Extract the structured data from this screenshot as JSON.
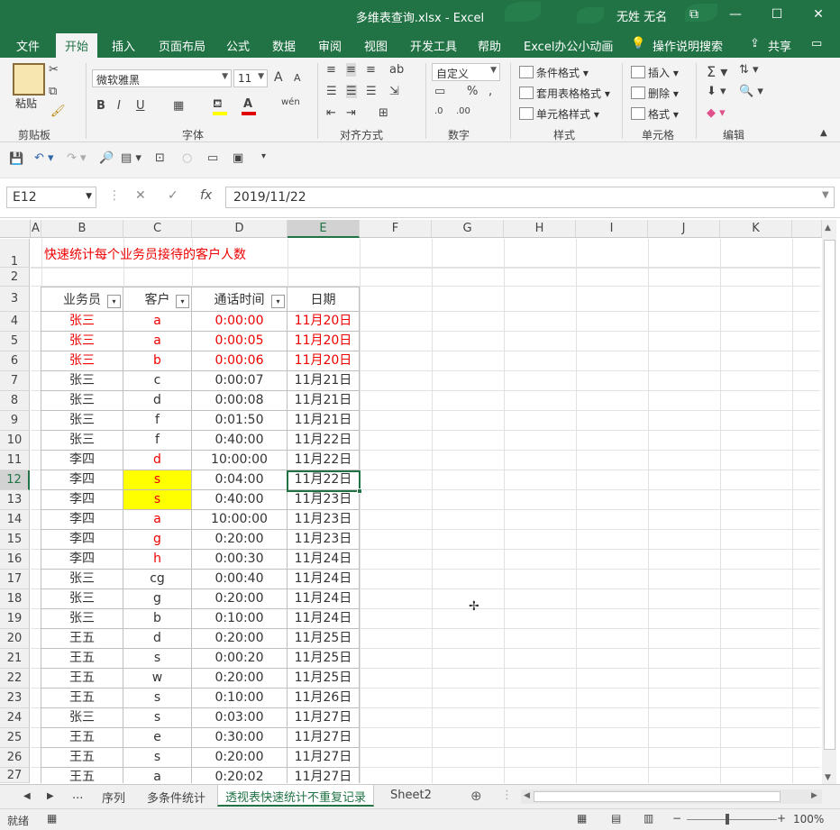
{
  "window": {
    "title": "多维表查询.xlsx  -  Excel",
    "user": "无姓 无名",
    "controls": [
      "⧉",
      "—",
      "☐",
      "✕"
    ]
  },
  "ribbon_tabs": [
    "文件",
    "开始",
    "插入",
    "页面布局",
    "公式",
    "数据",
    "审阅",
    "视图",
    "开发工具",
    "帮助",
    "Excel办公小动画",
    "操作说明搜索",
    "共享"
  ],
  "ribbon": {
    "clipboard": {
      "paste": "粘贴",
      "label": "剪贴板"
    },
    "font": {
      "name": "微软雅黑",
      "size": "11",
      "bold": "B",
      "italic": "I",
      "underline": "U",
      "grow": "A",
      "shrink": "A",
      "fill_color": "#ffff00",
      "font_color": "#e00000",
      "label": "字体",
      "phonetic": "wén"
    },
    "alignment": {
      "label": "对齐方式"
    },
    "number": {
      "format": "自定义",
      "label": "数字"
    },
    "styles": {
      "cond": "条件格式",
      "table": "套用表格格式",
      "cell": "单元格样式",
      "label": "样式"
    },
    "cells": {
      "insert": "插入",
      "delete": "删除",
      "format": "格式",
      "label": "单元格"
    },
    "editing": {
      "label": "编辑"
    }
  },
  "formula_bar": {
    "name_box": "E12",
    "cancel": "✕",
    "enter": "✓",
    "fx": "fx",
    "value": "2019/11/22"
  },
  "columns": [
    "A",
    "B",
    "C",
    "D",
    "E",
    "F",
    "G",
    "H",
    "I",
    "J",
    "K"
  ],
  "rows": [
    "1",
    "2",
    "3",
    "4",
    "5",
    "6",
    "7",
    "8",
    "9",
    "10",
    "11",
    "12",
    "13",
    "14",
    "15",
    "16",
    "17",
    "18",
    "19",
    "20",
    "21",
    "22",
    "23",
    "24",
    "25",
    "26",
    "27"
  ],
  "sheet_title": "快速统计每个业务员接待的客户人数",
  "table": {
    "headers": [
      "业务员",
      "客户",
      "通话时间",
      "日期"
    ],
    "filter_glyph": "▾",
    "rows": [
      {
        "name": "张三",
        "client": "a",
        "time": "0:00:00",
        "date": "11月20日"
      },
      {
        "name": "张三",
        "client": "a",
        "time": "0:00:05",
        "date": "11月20日"
      },
      {
        "name": "张三",
        "client": "b",
        "time": "0:00:06",
        "date": "11月20日"
      },
      {
        "name": "张三",
        "client": "c",
        "time": "0:00:07",
        "date": "11月21日"
      },
      {
        "name": "张三",
        "client": "d",
        "time": "0:00:08",
        "date": "11月21日"
      },
      {
        "name": "张三",
        "client": "f",
        "time": "0:01:50",
        "date": "11月21日"
      },
      {
        "name": "张三",
        "client": "f",
        "time": "0:40:00",
        "date": "11月22日"
      },
      {
        "name": "李四",
        "client": "d",
        "time": "10:00:00",
        "date": "11月22日"
      },
      {
        "name": "李四",
        "client": "s",
        "time": "0:04:00",
        "date": "11月22日"
      },
      {
        "name": "李四",
        "client": "s",
        "time": "0:40:00",
        "date": "11月23日"
      },
      {
        "name": "李四",
        "client": "a",
        "time": "10:00:00",
        "date": "11月23日"
      },
      {
        "name": "李四",
        "client": "g",
        "time": "0:20:00",
        "date": "11月23日"
      },
      {
        "name": "李四",
        "client": "h",
        "time": "0:00:30",
        "date": "11月24日"
      },
      {
        "name": "张三",
        "client": "cg",
        "time": "0:00:40",
        "date": "11月24日"
      },
      {
        "name": "张三",
        "client": "g",
        "time": "0:20:00",
        "date": "11月24日"
      },
      {
        "name": "张三",
        "client": "b",
        "time": "0:10:00",
        "date": "11月24日"
      },
      {
        "name": "王五",
        "client": "d",
        "time": "0:20:00",
        "date": "11月25日"
      },
      {
        "name": "王五",
        "client": "s",
        "time": "0:00:20",
        "date": "11月25日"
      },
      {
        "name": "王五",
        "client": "w",
        "time": "0:20:00",
        "date": "11月25日"
      },
      {
        "name": "王五",
        "client": "s",
        "time": "0:10:00",
        "date": "11月26日"
      },
      {
        "name": "张三",
        "client": "s",
        "time": "0:03:00",
        "date": "11月27日"
      },
      {
        "name": "王五",
        "client": "e",
        "time": "0:30:00",
        "date": "11月27日"
      },
      {
        "name": "王五",
        "client": "s",
        "time": "0:20:00",
        "date": "11月27日"
      },
      {
        "name": "王五",
        "client": "a",
        "time": "0:20:02",
        "date": "11月27日"
      }
    ]
  },
  "sheet_tabs": [
    "...",
    "序列",
    "多条件统计",
    "透视表快速统计不重复记录",
    "Sheet2"
  ],
  "active_sheet": "透视表快速统计不重复记录",
  "status": {
    "ready": "就绪",
    "zoom": "100%"
  },
  "colors": {
    "accent": "#217346",
    "red_text": "#e00000",
    "highlight": "#ffff00"
  }
}
